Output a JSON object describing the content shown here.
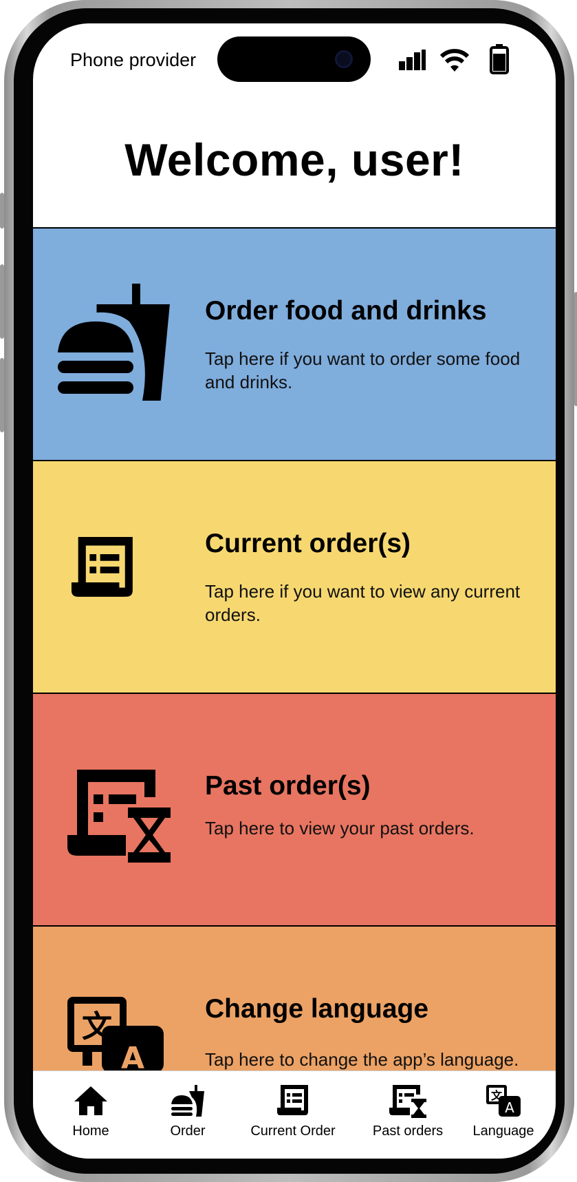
{
  "status_bar": {
    "provider": "Phone provider",
    "icons": [
      "signal-icon",
      "wifi-icon",
      "battery-icon"
    ]
  },
  "header": {
    "title": "Welcome, user!"
  },
  "cards": [
    {
      "title": "Order food and drinks",
      "description": "Tap here if you want to order some food and drinks.",
      "icon": "food-drink-icon",
      "color": "#7FADDC"
    },
    {
      "title": "Current order(s)",
      "description": "Tap here if you want to view any current orders.",
      "icon": "receipt-icon",
      "color": "#F7D870"
    },
    {
      "title": "Past order(s)",
      "description": "Tap here to view your past orders.",
      "icon": "receipt-history-icon",
      "color": "#E87561"
    },
    {
      "title": "Change language",
      "description": "Tap here to change the app’s language.",
      "icon": "translate-icon",
      "color": "#ECA265"
    }
  ],
  "bottom_nav": {
    "items": [
      {
        "label": "Home",
        "icon": "home-icon"
      },
      {
        "label": "Order",
        "icon": "food-drink-icon"
      },
      {
        "label": "Current Order",
        "icon": "receipt-icon"
      },
      {
        "label": "Past orders",
        "icon": "receipt-history-icon"
      },
      {
        "label": "Language",
        "icon": "translate-icon"
      }
    ]
  }
}
